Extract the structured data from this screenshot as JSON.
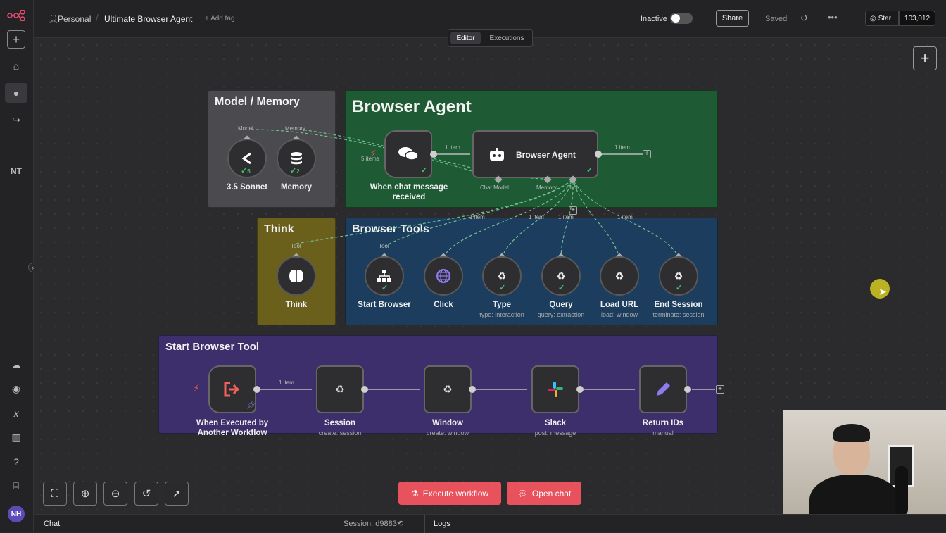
{
  "topbar": {
    "project": "Personal",
    "workflow_name": "Ultimate Browser Agent",
    "add_tag": "+ Add tag",
    "status_label": "Inactive",
    "share": "Share",
    "saved": "Saved",
    "star": "Star",
    "star_count": "103,012"
  },
  "tabs": {
    "editor": "Editor",
    "executions": "Executions"
  },
  "sidebar": {
    "initials": "NT",
    "avatar": "NH"
  },
  "groups": {
    "model_memory": "Model / Memory",
    "browser_agent": "Browser Agent",
    "think": "Think",
    "browser_tools": "Browser Tools",
    "start_browser_tool": "Start Browser Tool"
  },
  "nodes": {
    "sonnet": {
      "label": "3.5 Sonnet",
      "port": "Model",
      "badge": "5"
    },
    "memory": {
      "label": "Memory",
      "port": "Memory",
      "badge": "2"
    },
    "chat_trigger": {
      "label": "When chat message received",
      "items": "5 items"
    },
    "agent": {
      "label": "Browser Agent",
      "port_model": "Chat Model",
      "port_memory": "Memory",
      "port_tool": "Tool"
    },
    "think": {
      "label": "Think",
      "port": "Tool"
    },
    "start_browser": {
      "label": "Start Browser",
      "port": "Tool"
    },
    "click": {
      "label": "Click"
    },
    "type": {
      "label": "Type",
      "sub": "type: interaction"
    },
    "query": {
      "label": "Query",
      "sub": "query: extraction"
    },
    "load_url": {
      "label": "Load URL",
      "sub": "load: window"
    },
    "end_session": {
      "label": "End Session",
      "sub": "terminate: session"
    },
    "exec_trigger": {
      "label": "When Executed by Another Workflow"
    },
    "session": {
      "label": "Session",
      "sub": "create: session"
    },
    "window": {
      "label": "Window",
      "sub": "create: window"
    },
    "slack": {
      "label": "Slack",
      "sub": "post: message"
    },
    "return_ids": {
      "label": "Return IDs",
      "sub": "manual"
    }
  },
  "edges": {
    "one_item": "1 item"
  },
  "actions": {
    "execute": "Execute workflow",
    "open_chat": "Open chat"
  },
  "bottom": {
    "chat": "Chat",
    "session": "Session: d9883",
    "logs": "Logs"
  },
  "colors": {
    "model_memory": "#4a4a4f",
    "browser_agent": "#1e5a34",
    "think": "#6b5f1c",
    "browser_tools": "#1c3d5e",
    "start_browser_tool": "#3d2f6b",
    "execute": "#e8525c",
    "accent": "#ea4b71"
  }
}
